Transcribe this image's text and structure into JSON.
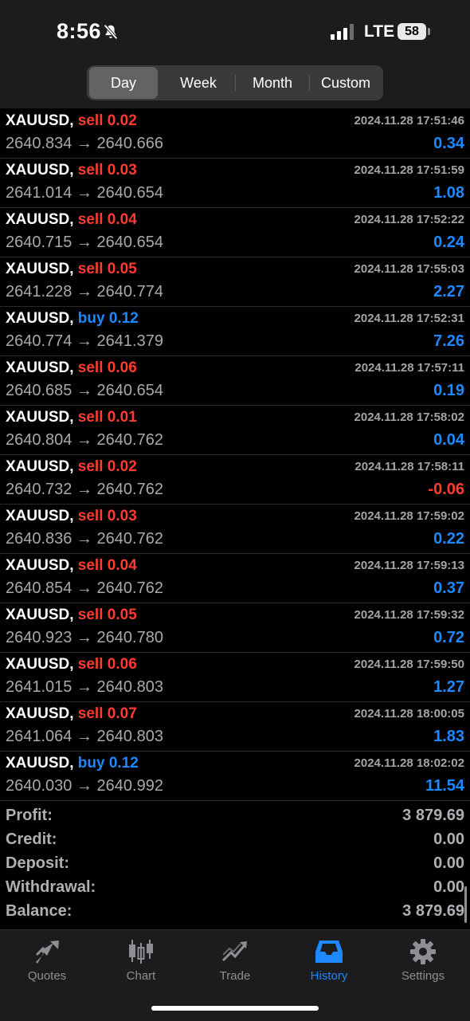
{
  "status": {
    "time": "8:56",
    "network": "LTE",
    "battery": "58"
  },
  "period_tabs": [
    {
      "label": "Day",
      "active": true
    },
    {
      "label": "Week",
      "active": false
    },
    {
      "label": "Month",
      "active": false
    },
    {
      "label": "Custom",
      "active": false
    }
  ],
  "deals": [
    {
      "symbol": "XAUUSD,",
      "side": "sell",
      "volume": "0.02",
      "datetime": "2024.11.28 17:51:46",
      "open": "2640.834",
      "close": "2640.666",
      "profit": "0.34"
    },
    {
      "symbol": "XAUUSD,",
      "side": "sell",
      "volume": "0.03",
      "datetime": "2024.11.28 17:51:59",
      "open": "2641.014",
      "close": "2640.654",
      "profit": "1.08"
    },
    {
      "symbol": "XAUUSD,",
      "side": "sell",
      "volume": "0.04",
      "datetime": "2024.11.28 17:52:22",
      "open": "2640.715",
      "close": "2640.654",
      "profit": "0.24"
    },
    {
      "symbol": "XAUUSD,",
      "side": "sell",
      "volume": "0.05",
      "datetime": "2024.11.28 17:55:03",
      "open": "2641.228",
      "close": "2640.774",
      "profit": "2.27"
    },
    {
      "symbol": "XAUUSD,",
      "side": "buy",
      "volume": "0.12",
      "datetime": "2024.11.28 17:52:31",
      "open": "2640.774",
      "close": "2641.379",
      "profit": "7.26"
    },
    {
      "symbol": "XAUUSD,",
      "side": "sell",
      "volume": "0.06",
      "datetime": "2024.11.28 17:57:11",
      "open": "2640.685",
      "close": "2640.654",
      "profit": "0.19"
    },
    {
      "symbol": "XAUUSD,",
      "side": "sell",
      "volume": "0.01",
      "datetime": "2024.11.28 17:58:02",
      "open": "2640.804",
      "close": "2640.762",
      "profit": "0.04"
    },
    {
      "symbol": "XAUUSD,",
      "side": "sell",
      "volume": "0.02",
      "datetime": "2024.11.28 17:58:11",
      "open": "2640.732",
      "close": "2640.762",
      "profit": "-0.06"
    },
    {
      "symbol": "XAUUSD,",
      "side": "sell",
      "volume": "0.03",
      "datetime": "2024.11.28 17:59:02",
      "open": "2640.836",
      "close": "2640.762",
      "profit": "0.22"
    },
    {
      "symbol": "XAUUSD,",
      "side": "sell",
      "volume": "0.04",
      "datetime": "2024.11.28 17:59:13",
      "open": "2640.854",
      "close": "2640.762",
      "profit": "0.37"
    },
    {
      "symbol": "XAUUSD,",
      "side": "sell",
      "volume": "0.05",
      "datetime": "2024.11.28 17:59:32",
      "open": "2640.923",
      "close": "2640.780",
      "profit": "0.72"
    },
    {
      "symbol": "XAUUSD,",
      "side": "sell",
      "volume": "0.06",
      "datetime": "2024.11.28 17:59:50",
      "open": "2641.015",
      "close": "2640.803",
      "profit": "1.27"
    },
    {
      "symbol": "XAUUSD,",
      "side": "sell",
      "volume": "0.07",
      "datetime": "2024.11.28 18:00:05",
      "open": "2641.064",
      "close": "2640.803",
      "profit": "1.83"
    },
    {
      "symbol": "XAUUSD,",
      "side": "buy",
      "volume": "0.12",
      "datetime": "2024.11.28 18:02:02",
      "open": "2640.030",
      "close": "2640.992",
      "profit": "11.54"
    }
  ],
  "summary": [
    {
      "label": "Profit:",
      "value": "3 879.69"
    },
    {
      "label": "Credit:",
      "value": "0.00"
    },
    {
      "label": "Deposit:",
      "value": "0.00"
    },
    {
      "label": "Withdrawal:",
      "value": "0.00"
    },
    {
      "label": "Balance:",
      "value": "3 879.69"
    }
  ],
  "tabs": [
    {
      "label": "Quotes",
      "icon": "quotes-icon",
      "active": false
    },
    {
      "label": "Chart",
      "icon": "chart-icon",
      "active": false
    },
    {
      "label": "Trade",
      "icon": "trade-icon",
      "active": false
    },
    {
      "label": "History",
      "icon": "history-icon",
      "active": true
    },
    {
      "label": "Settings",
      "icon": "settings-icon",
      "active": false
    }
  ],
  "colors": {
    "sell": "#ff3b30",
    "buy": "#1e88ff",
    "profit_positive": "#1e88ff",
    "profit_negative": "#ff3b30",
    "tab_active": "#1e88ff"
  }
}
